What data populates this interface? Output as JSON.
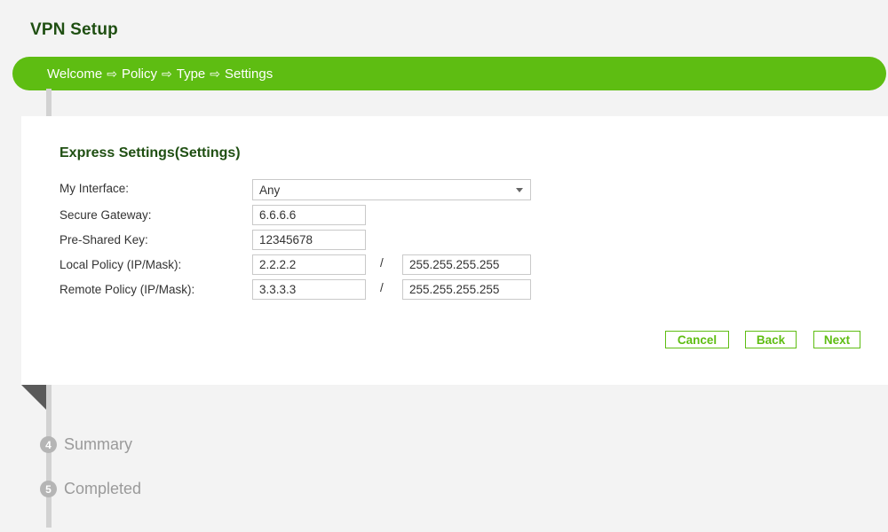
{
  "header": {
    "title": "VPN Setup"
  },
  "wizard": {
    "steps": [
      "Welcome",
      "Policy",
      "Type",
      "Settings"
    ],
    "arrow": "⇨"
  },
  "form": {
    "section_title": "Express Settings(Settings)",
    "my_interface": {
      "label": "My Interface:",
      "value": "Any"
    },
    "secure_gateway": {
      "label": "Secure Gateway:",
      "value": "6.6.6.6"
    },
    "pre_shared_key": {
      "label": "Pre-Shared Key:",
      "value": "12345678"
    },
    "local_policy": {
      "label": "Local Policy (IP/Mask):",
      "ip": "2.2.2.2",
      "mask": "255.255.255.255"
    },
    "remote_policy": {
      "label": "Remote Policy (IP/Mask):",
      "ip": "3.3.3.3",
      "mask": "255.255.255.255"
    },
    "separator": "/"
  },
  "buttons": {
    "cancel": "Cancel",
    "back": "Back",
    "next": "Next"
  },
  "remaining_steps": [
    {
      "number": "4",
      "label": "Summary"
    },
    {
      "number": "5",
      "label": "Completed"
    }
  ],
  "colors": {
    "accent_green": "#5ebd12",
    "title_green": "#1f4f12",
    "step_gray": "#b5b5b5"
  }
}
